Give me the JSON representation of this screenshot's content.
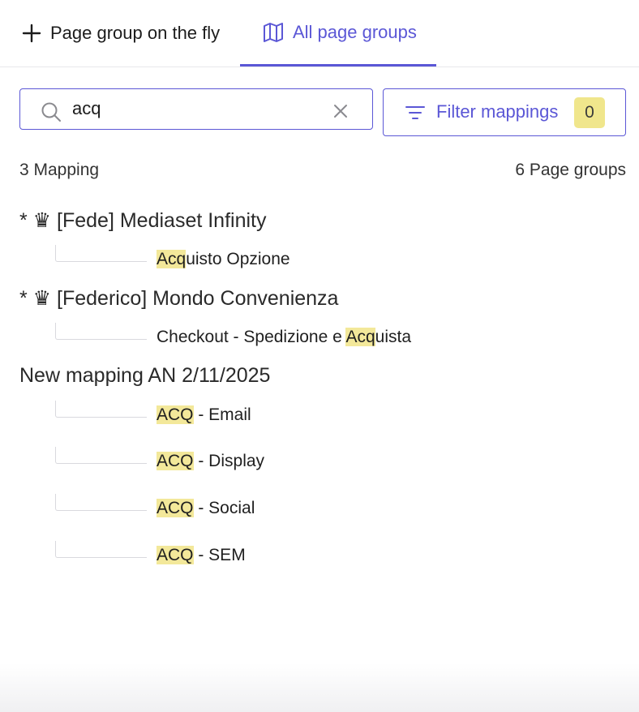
{
  "tabs": {
    "fly_label": "Page group on the fly",
    "all_label": "All page groups"
  },
  "search": {
    "value": "acq",
    "placeholder": ""
  },
  "filter": {
    "label": "Filter mappings",
    "count": "0"
  },
  "summary": {
    "mappings": "3 Mapping",
    "page_groups": "6 Page groups"
  },
  "colors": {
    "accent": "#5b57d6",
    "highlight": "#f3e89a",
    "badge": "#f0e68c"
  },
  "tree": [
    {
      "name": "* ♛ [Fede] Mediaset Infinity",
      "items": [
        {
          "match": "Acq",
          "rest": "uisto Opzione",
          "pre": ""
        }
      ]
    },
    {
      "name": "* ♛ [Federico] Mondo Convenienza",
      "items": [
        {
          "pre": "Checkout - Spedizione e ",
          "match": "Acq",
          "rest": "uista"
        }
      ]
    },
    {
      "name": "New mapping AN 2/11/2025",
      "items": [
        {
          "pre": "",
          "match": "ACQ",
          "rest": " - Email"
        },
        {
          "pre": "",
          "match": "ACQ",
          "rest": " - Display"
        },
        {
          "pre": "",
          "match": "ACQ",
          "rest": " - Social"
        },
        {
          "pre": "",
          "match": "ACQ",
          "rest": " - SEM"
        }
      ]
    }
  ]
}
